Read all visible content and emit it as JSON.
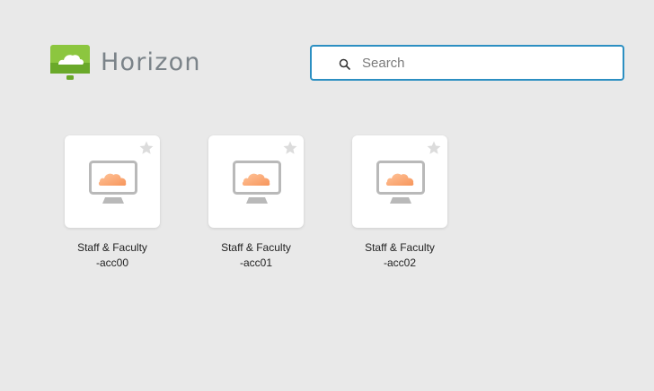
{
  "brand": {
    "name": "Horizon",
    "logo_icon": "horizon-cloud-monitor-icon",
    "accent_green": "#8cc63f"
  },
  "search": {
    "placeholder": "Search",
    "value": "",
    "icon": "search-icon",
    "border_color": "#2c8fc2"
  },
  "desktops": [
    {
      "line1": "Staff & Faculty",
      "line2": "-acc00",
      "favorite": false,
      "icon": "desktop-monitor-icon"
    },
    {
      "line1": "Staff & Faculty",
      "line2": "-acc01",
      "favorite": false,
      "icon": "desktop-monitor-icon"
    },
    {
      "line1": "Staff & Faculty",
      "line2": "-acc02",
      "favorite": false,
      "icon": "desktop-monitor-icon"
    }
  ]
}
